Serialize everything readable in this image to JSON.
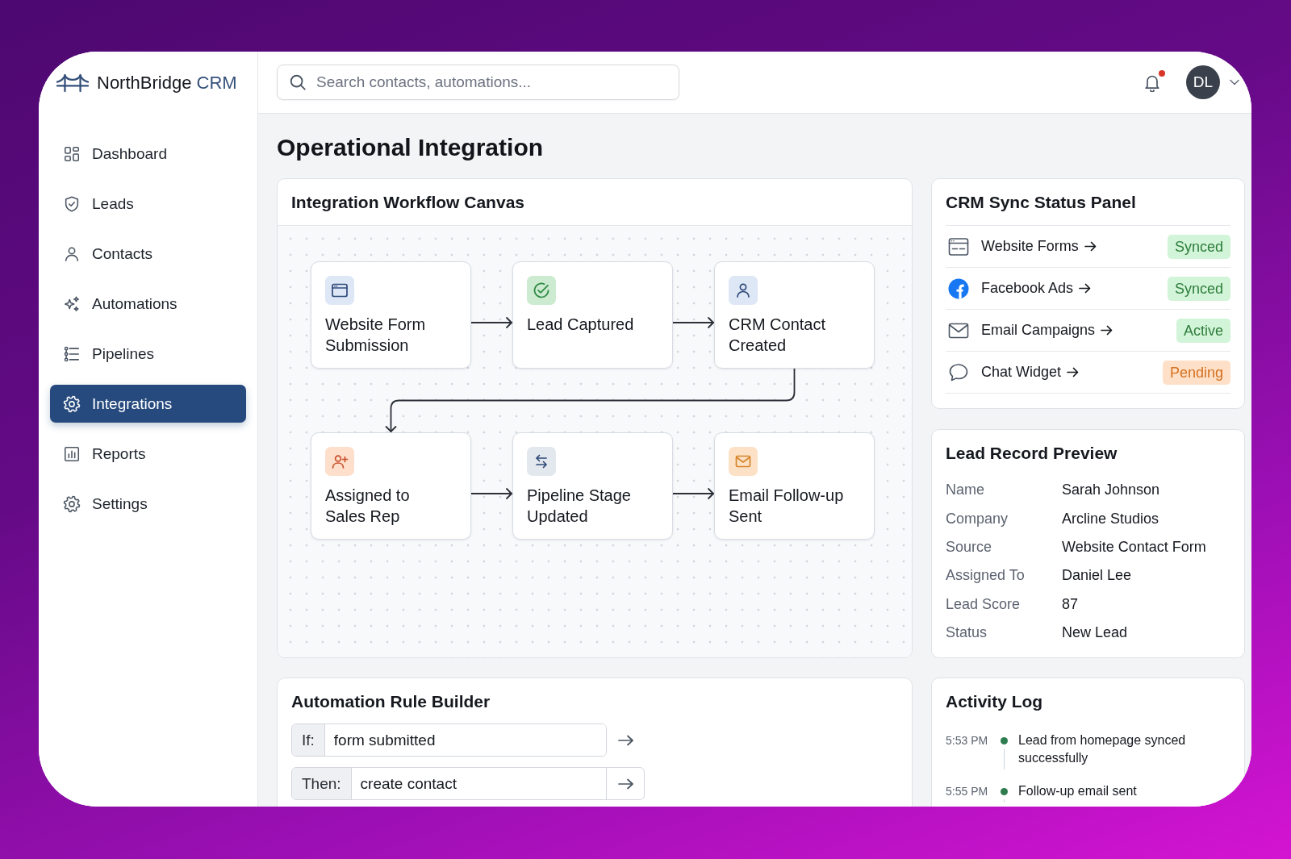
{
  "sidebar": {
    "brand": {
      "name": "NorthBridge",
      "suffix": "CRM"
    },
    "items": [
      {
        "label": "Dashboard",
        "selected": false
      },
      {
        "label": "Leads",
        "selected": false
      },
      {
        "label": "Contacts",
        "selected": false
      },
      {
        "label": "Automations",
        "selected": false
      },
      {
        "label": "Pipelines",
        "selected": false
      },
      {
        "label": "Integrations",
        "selected": true
      },
      {
        "label": "Reports",
        "selected": false
      },
      {
        "label": "Settings",
        "selected": false
      }
    ]
  },
  "topbar": {
    "search": {
      "placeholder": "Search contacts, automations..."
    },
    "notifications": {
      "unread": true
    },
    "user": {
      "initials": "DL"
    }
  },
  "page": {
    "title": "Operational Integration"
  },
  "workflow_canvas": {
    "title": "Integration Workflow Canvas",
    "nodes": [
      {
        "label": "Website Form Submission"
      },
      {
        "label": "Lead Captured"
      },
      {
        "label": "CRM Contact Created"
      },
      {
        "label": "Assigned to Sales Rep"
      },
      {
        "label": "Pipeline Stage Updated"
      },
      {
        "label": "Email Follow-up Sent"
      }
    ]
  },
  "sync_panel": {
    "title": "CRM Sync Status Panel",
    "items": [
      {
        "label": "Website Forms",
        "status": "Synced",
        "color": "#2e7d3b"
      },
      {
        "label": "Facebook Ads",
        "status": "Synced",
        "color": "#2e7d3b"
      },
      {
        "label": "Email Campaigns",
        "status": "Active",
        "color": "#2e7d3b"
      },
      {
        "label": "Chat Widget",
        "status": "Pending",
        "color": "#d4701f"
      }
    ]
  },
  "lead_preview": {
    "title": "Lead Record Preview",
    "fields": [
      {
        "label": "Name",
        "value": "Sarah Johnson"
      },
      {
        "label": "Company",
        "value": "Arcline Studios"
      },
      {
        "label": "Source",
        "value": "Website Contact Form"
      },
      {
        "label": "Assigned To",
        "value": "Daniel Lee"
      },
      {
        "label": "Lead Score",
        "value": "87"
      },
      {
        "label": "Status",
        "value": "New Lead"
      }
    ]
  },
  "rule_builder": {
    "title": "Automation Rule Builder",
    "rules": [
      {
        "label": "If:",
        "value": "form submitted",
        "arrow_boxed": false
      },
      {
        "label": "Then:",
        "value": "create contact",
        "arrow_boxed": true
      }
    ]
  },
  "activity_log": {
    "title": "Activity Log",
    "entries": [
      {
        "time": "5:53 PM",
        "text": "Lead from homepage synced successfully"
      },
      {
        "time": "5:55 PM",
        "text": "Follow-up email sent"
      }
    ]
  }
}
